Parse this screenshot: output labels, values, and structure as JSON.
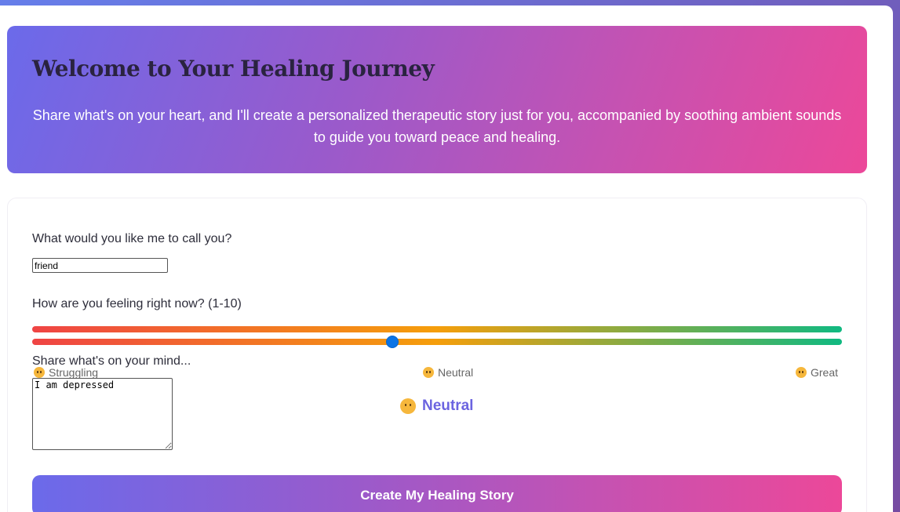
{
  "hero": {
    "title": "Welcome to Your Healing Journey",
    "subtitle": "Share what's on your heart, and I'll create a personalized therapeutic story just for you, accompanied by soothing ambient sounds to guide you toward peace and healing."
  },
  "form": {
    "name_label": "What would you like me to call you?",
    "name_value": "friend",
    "mood_label": "How are you feeling right now? (1-10)",
    "mood_value": 5,
    "mood_min": 1,
    "mood_max": 10,
    "scale_low": "Struggling",
    "scale_mid": "Neutral",
    "scale_high": "Great",
    "mood_current": "Neutral",
    "mind_label": "Share what's on your mind...",
    "mind_value": "I am depressed",
    "submit_label": "Create My Healing Story"
  },
  "colors": {
    "accent": "#6b63e0",
    "gradient_start": "#6b6aea",
    "gradient_end": "#ec4899",
    "slider_thumb": "#0b74e5"
  },
  "icons": {
    "scale_low": "sad-face-icon",
    "scale_mid": "neutral-face-icon",
    "scale_high": "smile-face-icon",
    "current": "neutral-face-icon"
  }
}
